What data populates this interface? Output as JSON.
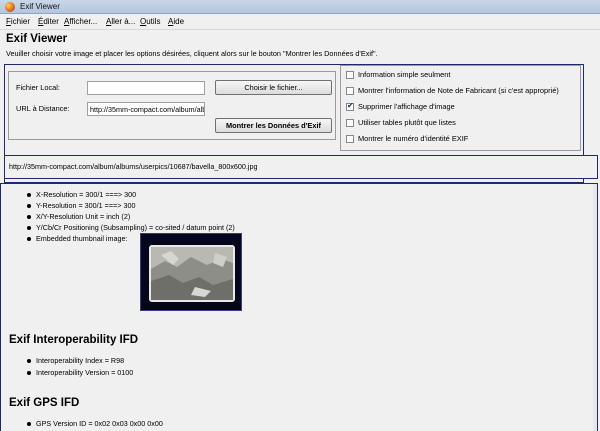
{
  "window": {
    "title": "Exif Viewer"
  },
  "menu": [
    {
      "acc": "F",
      "rest": "ichier"
    },
    {
      "acc": "É",
      "rest": "diter"
    },
    {
      "acc": "A",
      "rest": "fficher..."
    },
    {
      "acc": "A",
      "rest": "ller à..."
    },
    {
      "acc": "O",
      "rest": "utils"
    },
    {
      "acc": "A",
      "rest": "ide"
    }
  ],
  "app": {
    "title": "Exif Viewer",
    "instructions": "Veuiller choisir votre image et placer les options désirées, cliquent alors sur le bouton \"Montrer les Données d'Exif\"."
  },
  "form": {
    "local_label": "Fichier Local:",
    "local_value": "",
    "remote_label": "URL à Distance:",
    "remote_value": "http://35mm-compact.com/album/albums/userpics/10687/bavella_800x600.jpg",
    "choose_button": "Choisir le fichier...",
    "show_button": "Montrer les Données d'Exif"
  },
  "options": [
    {
      "label": "Information simple seulment",
      "checked": false
    },
    {
      "label": "Montrer l'information de Note de Fabricant (si c'est approprié)",
      "checked": false
    },
    {
      "label": "Supprimer l'affichage d'image",
      "checked": true
    },
    {
      "label": "Utiliser tables plutôt que listes",
      "checked": false
    },
    {
      "label": "Montrer le numéro d'identité EXIF",
      "checked": false
    }
  ],
  "current_url": "http://35mm-compact.com/album/albums/userpics/10687/bavella_800x600.jpg",
  "results": {
    "ifd1_items": [
      "X-Resolution = 300/1 ===> 300",
      "Y-Resolution = 300/1 ===> 300",
      "X/Y-Resolution Unit = inch (2)",
      "Y/Cb/Cr Positioning (Subsampling) = co-sited / datum point (2)",
      "Embedded thumbnail image:"
    ],
    "interop_heading": "Exif Interoperability IFD",
    "interop_items": [
      "Interoperability Index = R98",
      "Interoperability Version = 0100"
    ],
    "gps_heading": "Exif GPS IFD",
    "gps_items": [
      "GPS Version ID = 0x02 0x03 0x00 0x00"
    ]
  }
}
